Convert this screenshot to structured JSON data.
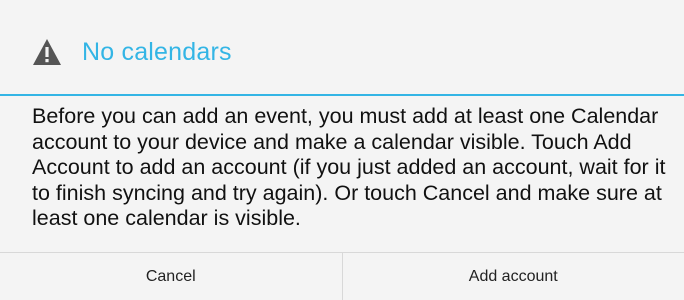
{
  "dialog": {
    "title": "No calendars",
    "icon": "warning-icon",
    "accent_color": "#33b5e5",
    "message": "Before you can add an event, you must add at least one Calendar account to your device and make a calendar visible. Touch Add Account to add an account (if you just added an account, wait for it to finish syncing and try again). Or touch Cancel and make sure at least one calendar is visible.",
    "buttons": {
      "cancel_label": "Cancel",
      "add_account_label": "Add account"
    }
  }
}
